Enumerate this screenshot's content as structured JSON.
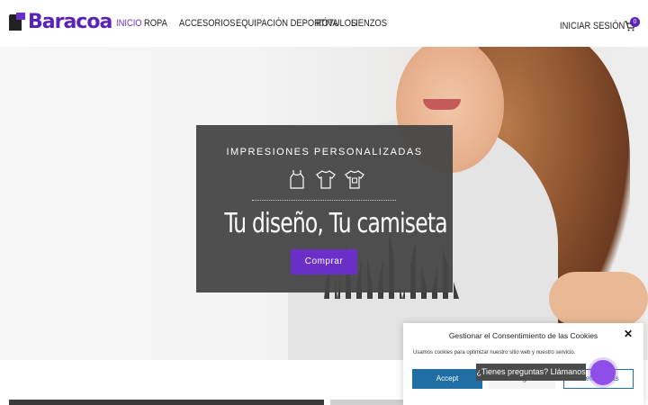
{
  "header": {
    "logo_text": "Baracoa",
    "nav": [
      {
        "label": "INICIO",
        "active": true
      },
      {
        "label": "ROPA",
        "active": false
      },
      {
        "label": "ACCESORIOS",
        "active": false
      },
      {
        "label": "EQUIPACIÓN DEPORTIVA",
        "active": false
      },
      {
        "label": "RÓTULOS",
        "active": false
      },
      {
        "label": "LIENZOS",
        "active": false
      }
    ],
    "login_label": "INICIAR SESIÓN",
    "cart_count": "0",
    "cart_icon": "cart-icon"
  },
  "hero": {
    "subtitle": "IMPRESIONES PERSONALIZADAS",
    "icons": [
      "tank-top-icon",
      "tshirt-icon",
      "printed-tshirt-icon"
    ],
    "headline": "Tu diseño, Tu camiseta",
    "cta_label": "Comprar"
  },
  "cookie": {
    "title": "Gestionar el Consentimiento de las Cookies",
    "description": "Usamos cookies para optimizar nuestro sitio web y nuestro servicio.",
    "accept_label": "Accept",
    "deny_label": "Denegado",
    "prefs_label": "Preferencias",
    "close_icon": "close-icon"
  },
  "chat": {
    "label": "¿Tienes preguntas? Llámanos"
  },
  "colors": {
    "brand": "#6a2fc6",
    "accept_blue": "#1f6fa5",
    "overlay": "#464646"
  }
}
